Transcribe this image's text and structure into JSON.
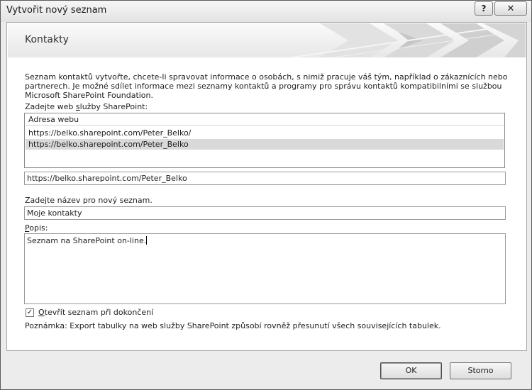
{
  "window": {
    "title": "Vytvořit nový seznam",
    "help_label": "?",
    "close_label": "✕"
  },
  "banner": {
    "title": "Kontakty"
  },
  "description": "Seznam kontaktů vytvořte, chcete-li spravovat informace o osobách, s nimiž pracuje váš tým, například o zákaznících nebo partnerech. Je možné sdílet informace mezi seznamy kontaktů a programy pro správu kontaktů kompatibilními se službou Microsoft SharePoint Foundation.",
  "web_site": {
    "label_before": "Zadejte web ",
    "label_underlined": "s",
    "label_after": "lužby SharePoint:",
    "column_header": "Adresa webu",
    "items": [
      "https://belko.sharepoint.com/Peter_Belko/",
      "https://belko.sharepoint.com/Peter_Belko"
    ],
    "selected_index": 1,
    "url_value": "https://belko.sharepoint.com/Peter_Belko"
  },
  "list_name": {
    "label": "Zadejte název pro nový seznam.",
    "value": "Moje kontakty"
  },
  "description_field": {
    "label_underlined": "P",
    "label_after": "opis:",
    "value": "Seznam na SharePoint on-line."
  },
  "open_on_finish": {
    "checked": true,
    "check_glyph": "✓",
    "label_underlined": "O",
    "label_after": "tevřít seznam při dokončení"
  },
  "note": "Poznámka: Export tabulky na web služby SharePoint způsobí rovněž přesunutí všech souvisejících tabulek.",
  "buttons": {
    "ok": "OK",
    "cancel": "Storno"
  }
}
